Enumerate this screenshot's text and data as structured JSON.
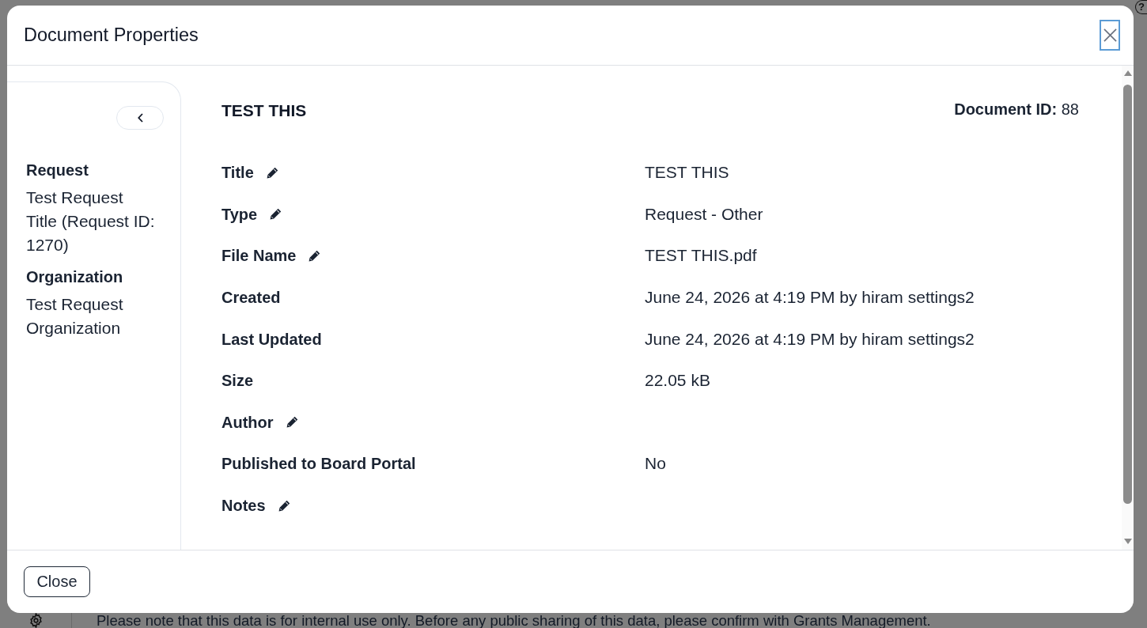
{
  "background": {
    "help_label": "?",
    "notice": "Please note that this data is for internal use only. Before any public sharing of this data, please confirm with Grants Management."
  },
  "dialog": {
    "title": "Document Properties",
    "close_button": {
      "focused": true
    },
    "sidebar": {
      "sections": [
        {
          "label": "Request",
          "value": "Test Request Title (Request ID: 1270)"
        },
        {
          "label": "Organization",
          "value": "Test Request Organization"
        }
      ]
    },
    "heading": "TEST THIS",
    "document_id": "**Document ID:** 88",
    "fields": [
      {
        "label": "Title",
        "editable": true,
        "value": "TEST THIS"
      },
      {
        "label": "Type",
        "editable": true,
        "value": "Request - Other"
      },
      {
        "label": "File Name",
        "editable": true,
        "value": "TEST THIS.pdf"
      },
      {
        "label": "Created",
        "editable": false,
        "value": "June 24, 2026 at 4:19 PM by hiram settings2"
      },
      {
        "label": "Last Updated",
        "editable": false,
        "value": "June 24, 2026 at 4:19 PM by hiram settings2"
      },
      {
        "label": "Size",
        "editable": false,
        "value": "22.05 kB"
      },
      {
        "label": "Author",
        "editable": true
      },
      {
        "label": "Published to Board Portal",
        "editable": false,
        "value": "No"
      },
      {
        "label": "Notes",
        "editable": true
      }
    ],
    "footer_button": "Close"
  }
}
